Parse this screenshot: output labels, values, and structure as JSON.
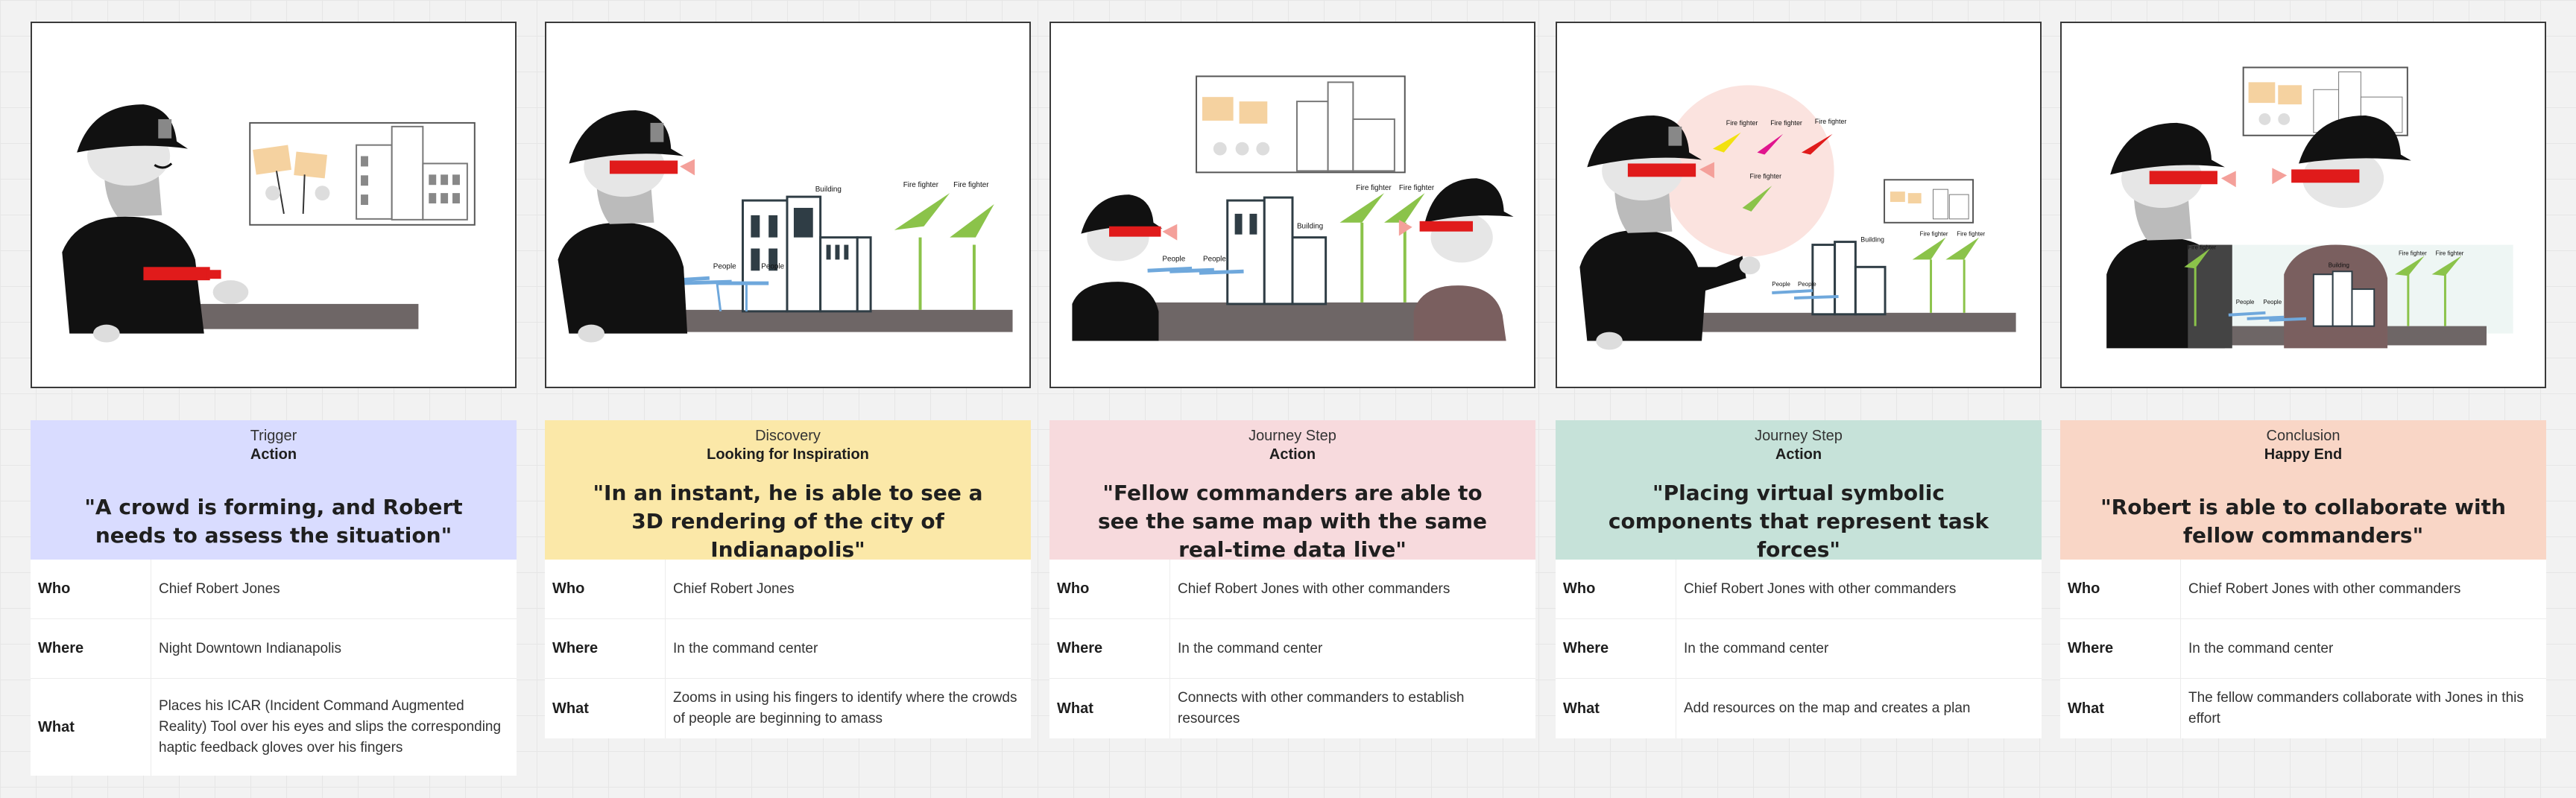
{
  "storyboard": [
    {
      "category": "Trigger",
      "subtitle": "Action",
      "quote": "\"A crowd is forming, and Robert needs to assess the situation\"",
      "color": "#d9dcff",
      "rows": [
        {
          "key": "Who",
          "value": "Chief Robert Jones"
        },
        {
          "key": "Where",
          "value": "Night Downtown Indianapolis"
        },
        {
          "key": "What",
          "value": "Places his ICAR (Incident Command Augmented Reality) Tool over his eyes and slips the corresponding haptic feedback gloves over his fingers"
        }
      ],
      "scene": {
        "labels": []
      }
    },
    {
      "category": "Discovery",
      "subtitle": "Looking for Inspiration",
      "quote": "\"In an instant, he is able to see a 3D rendering of the city of Indianapolis\"",
      "color": "#fbe8a8",
      "rows": [
        {
          "key": "Who",
          "value": "Chief Robert Jones"
        },
        {
          "key": "Where",
          "value": "In the command center"
        },
        {
          "key": "What",
          "value": "Zooms in using his fingers to identify where the crowds of people are beginning to amass"
        }
      ],
      "scene": {
        "labels": [
          "Building",
          "Fire fighter",
          "Fire fighter",
          "People",
          "People"
        ]
      }
    },
    {
      "category": "Journey Step",
      "subtitle": "Action",
      "quote": "\"Fellow commanders are able to see the same map with the same real-time data live\"",
      "color": "#f7dadd",
      "rows": [
        {
          "key": "Who",
          "value": "Chief Robert Jones with other commanders"
        },
        {
          "key": "Where",
          "value": "In the command center"
        },
        {
          "key": "What",
          "value": "Connects with other commanders to establish resources"
        }
      ],
      "scene": {
        "labels": [
          "Building",
          "Fire fighter",
          "Fire fighter",
          "People",
          "People"
        ]
      }
    },
    {
      "category": "Journey Step",
      "subtitle": "Action",
      "quote": "\"Placing virtual symbolic components that represent task forces\"",
      "color": "#c6e2d9",
      "rows": [
        {
          "key": "Who",
          "value": "Chief Robert Jones with other commanders"
        },
        {
          "key": "Where",
          "value": "In the command center"
        },
        {
          "key": "What",
          "value": "Add resources on the map and creates a plan"
        }
      ],
      "scene": {
        "labels": [
          "Fire fighter",
          "Fire fighter",
          "Fire fighter",
          "Fire fighter",
          "Building",
          "Fire fighter",
          "Fire fighter",
          "People",
          "People"
        ]
      }
    },
    {
      "category": "Conclusion",
      "subtitle": "Happy End",
      "quote": "\"Robert is able to collaborate with fellow commanders\"",
      "color": "#f9d6c6",
      "rows": [
        {
          "key": "Who",
          "value": "Chief Robert Jones with other commanders"
        },
        {
          "key": "Where",
          "value": "In the command center"
        },
        {
          "key": "What",
          "value": "The fellow commanders collaborate with Jones in this effort"
        }
      ],
      "scene": {
        "labels": [
          "Building",
          "Fire fighter",
          "Fire fighter",
          "Fire fighter",
          "People",
          "People"
        ]
      }
    }
  ]
}
